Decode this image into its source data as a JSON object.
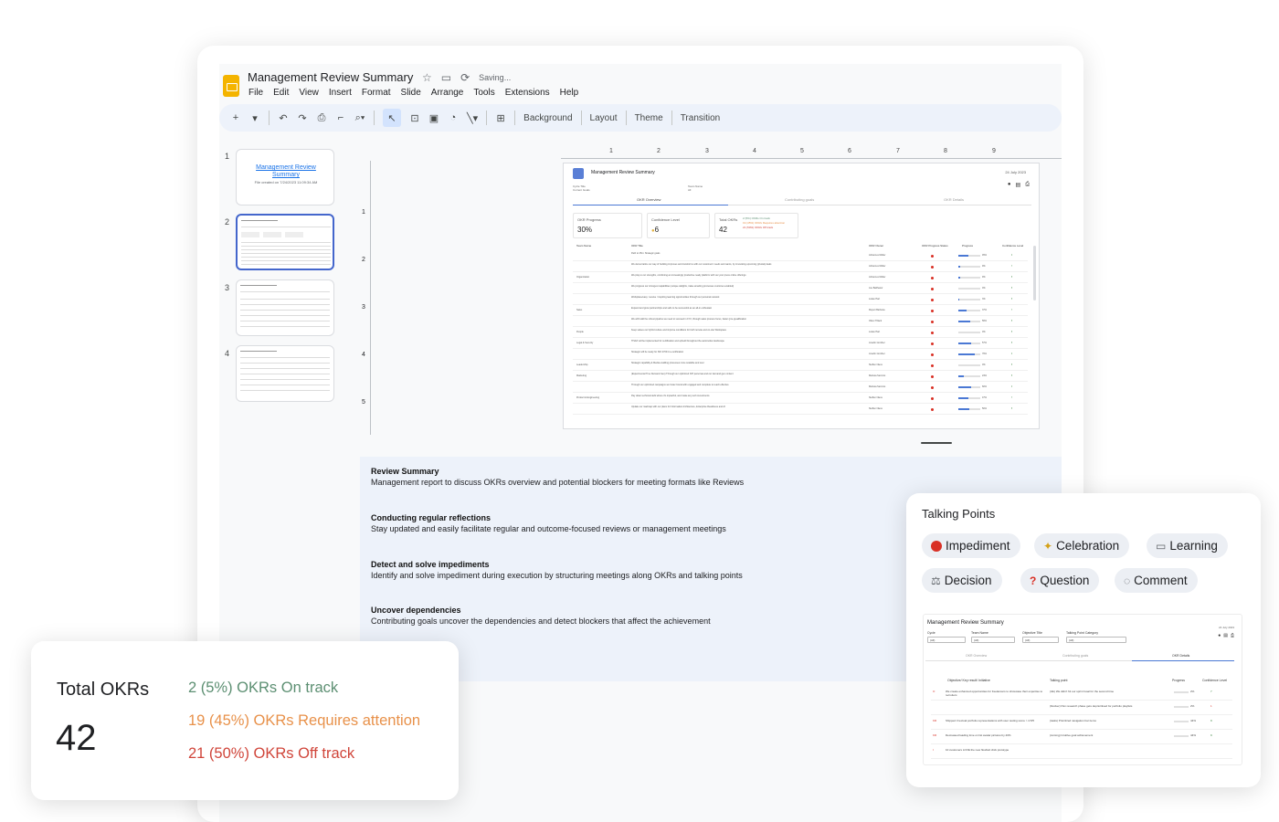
{
  "app": {
    "title": "Management Review Summary",
    "status": "Saving...",
    "menu": [
      "File",
      "Edit",
      "View",
      "Insert",
      "Format",
      "Slide",
      "Arrange",
      "Tools",
      "Extensions",
      "Help"
    ],
    "toolbar": {
      "background": "Background",
      "layout": "Layout",
      "theme": "Theme",
      "transition": "Transition"
    }
  },
  "filmstrip": {
    "slides": [
      {
        "number": "1",
        "title": "Management Review Summary",
        "subtitle": "File created on 7/24/2023 11:09:34 AM"
      },
      {
        "number": "2"
      },
      {
        "number": "3"
      },
      {
        "number": "4"
      }
    ]
  },
  "ruler": {
    "horizontal": [
      "1",
      "2",
      "3",
      "4",
      "5",
      "6",
      "7",
      "8",
      "9"
    ],
    "vertical": [
      "1",
      "2",
      "3",
      "4",
      "5"
    ]
  },
  "slide": {
    "title": "Management Review Summary",
    "date": "24 July 2023",
    "meta": {
      "cycle_label": "Cycle Title",
      "cycle_value": "Current Goals",
      "team_label": "Team Name",
      "team_value": "All"
    },
    "tabs": [
      "OKR Overview",
      "Contributing goals",
      "OKR Details"
    ],
    "cards": {
      "progress": {
        "label": "OKR Progress",
        "value": "30%"
      },
      "confidence": {
        "label": "Confidence Level",
        "value": "6"
      },
      "total": {
        "label": "Total OKRs",
        "value": "42",
        "on_track": "2 (5%) OKRs On track",
        "attention": "19 (45%) OKRs Requires attention",
        "off_track": "21 (50%) OKRs Off track"
      }
    },
    "table_headers": [
      "Team Name",
      "OKR Title",
      "OKR Owner",
      "OKR Progress Status",
      "Progress",
      "Confidence Level"
    ],
    "table_rows": [
      {
        "team": "",
        "title": "Path to 25m: Strategic goals",
        "owner": "Johannes Müller",
        "status": "#d93025",
        "progress": 0.45,
        "pct": "45%",
        "conf": "9"
      },
      {
        "team": "",
        "title": "We democratize our way of building improves and transforms with our customers' needs and wants, by innovating upcoming (pivotal) deals",
        "owner": "Johannes Müller",
        "status": "#d93025",
        "progress": 0.09,
        "pct": "9%",
        "conf": "7"
      },
      {
        "team": "Organization",
        "title": "We play to our strengths, combining an increasingly productive ready platform with our your press online offerings",
        "owner": "Johannes Müller",
        "status": "#d93025",
        "progress": 0.09,
        "pct": "9%",
        "conf": "8"
      },
      {
        "team": "",
        "title": "We progress our strongest capabilities (unique delights, make amazing processes customer-enabled)",
        "owner": "Joe Balthasor",
        "status": "#d93025",
        "progress": 0.0,
        "pct": "0%",
        "conf": "8"
      },
      {
        "team": "",
        "title": "Workplace/easy: receive / inspiring learning opportunities through our personal network",
        "owner": "Lukas Hart",
        "status": "#d93025",
        "progress": 0.03,
        "pct": "3%",
        "conf": "8"
      },
      {
        "team": "Sales",
        "title": "Expand and grow partnerships and sells to be successful as an all-in enthusiast",
        "owner": "Rupert Barbosa",
        "status": "#d93025",
        "progress": 0.37,
        "pct": "37%",
        "conf": "7"
      },
      {
        "team": "",
        "title": "We will build the robust pipeline we need to succeed in FY2, through sales process focus, faster (pre-)qualification",
        "owner": "Oliver Tillack",
        "status": "#d93025",
        "progress": 0.56,
        "pct": "56%",
        "conf": "8"
      },
      {
        "team": "People",
        "title": "Keep values our hybrid culture and improve conditions for both remote and on-site Workspace",
        "owner": "Lukas Hart",
        "status": "#d93025",
        "progress": 0.0,
        "pct": "0%",
        "conf": "8"
      },
      {
        "team": "Legal & Security",
        "title": "TISAX will be implemented for certification and upheld throughout the automotive landscape",
        "owner": "Josefin Günther",
        "status": "#d93025",
        "progress": 0.57,
        "pct": "57%",
        "conf": "8"
      },
      {
        "team": "",
        "title": "Strategic will be ready for ISO 27001 re-certification",
        "owner": "Josefin Günther",
        "status": "#d93025",
        "progress": 0.76,
        "pct": "76%",
        "conf": "9"
      },
      {
        "team": "Leadership",
        "title": "Strategic capability & Media enabling processes more scalable and over",
        "owner": "Steffen Niess",
        "status": "#d93025",
        "progress": 0.0,
        "pct": "0%",
        "conf": "8"
      },
      {
        "team": "Marketing",
        "title": "(Experimental True Demand Gen) Through our optimized ICP personas and our demand gen content",
        "owner": "Melissa Sammis",
        "status": "#d93025",
        "progress": 0.24,
        "pct": "24%",
        "conf": "8"
      },
      {
        "team": "",
        "title": "Through our optimized campaigns we foster brand with engaged and complete to reach effective",
        "owner": "Melissa Sammis",
        "status": "#d93025",
        "progress": 0.6,
        "pct": "60%",
        "conf": "9"
      },
      {
        "team": "Product & Engineering",
        "title": "Pay down technical debt where it's impactful, and make any tech investments",
        "owner": "Steffen Niess",
        "status": "#d93025",
        "progress": 0.47,
        "pct": "47%",
        "conf": "7"
      },
      {
        "team": "",
        "title": "Update our roadmap with our plans for Information Architecture, Enterprise Readiness and AI",
        "owner": "Steffen Niess",
        "status": "#d93025",
        "progress": 0.5,
        "pct": "50%",
        "conf": "8"
      }
    ]
  },
  "notes": [
    {
      "heading": "Review Summary",
      "text": "Management report to discuss OKRs overview and potential blockers for meeting formats like Reviews"
    },
    {
      "heading": "Conducting regular reflections",
      "text": "Stay updated and easily facilitate regular and outcome-focused reviews or management meetings"
    },
    {
      "heading": "Detect and solve impediments",
      "text": "Identify and solve impediment during execution by structuring meetings along OKRs and talking points"
    },
    {
      "heading": "Uncover dependencies",
      "text": "Contributing goals uncover the dependencies and detect blockers that affect the achievement"
    }
  ],
  "okr_summary": {
    "label": "Total OKRs",
    "count": "42",
    "on_track": "2 (5%) OKRs On track",
    "attention": "19 (45%) OKRs Requires attention",
    "off_track": "21 (50%) OKRs Off track",
    "colors": {
      "on_track": "#5c8f72",
      "attention": "#e8914a",
      "off_track": "#d0453a"
    }
  },
  "talking_points": {
    "title": "Talking Points",
    "chips": [
      {
        "label": "Impediment",
        "icon": "red-circle-icon"
      },
      {
        "label": "Celebration",
        "icon": "party-popper-icon"
      },
      {
        "label": "Learning",
        "icon": "book-icon"
      },
      {
        "label": "Decision",
        "icon": "scales-icon"
      },
      {
        "label": "Question",
        "icon": "question-mark-icon"
      },
      {
        "label": "Comment",
        "icon": "speech-bubble-icon"
      }
    ],
    "report": {
      "title": "Management Review Summary",
      "date": "24 July 2023",
      "filters": [
        {
          "label": "Cycle",
          "value": "(All)"
        },
        {
          "label": "Team Name",
          "value": "(All)"
        },
        {
          "label": "Objective Title",
          "value": "(All)"
        },
        {
          "label": "Talking Point Category",
          "value": "(All)"
        }
      ],
      "tabs": [
        "OKR Overview",
        "Contributing goals",
        "OKR Details"
      ],
      "headers": [
        "Objective/ Key result/ Initiative",
        "Talking point",
        "Progress",
        "Confidence Level"
      ],
      "rows": [
        {
          "marker": "O",
          "objective": "We create enhanced opportunities for freelancers to showcase their expertise to recruiters",
          "point": "(rkk) We didn't hit our sprint Goal for the second time",
          "pct": "2%",
          "conf": "7"
        },
        {
          "marker": "",
          "objective": "",
          "point": "(blocker) Pan research phase gets deprioritised for portfolio playlists",
          "pct": "2%",
          "conf": "1"
        },
        {
          "marker": "KR",
          "objective": "Shipped 3 textual portfolio representations with user testing score > 4.5/5",
          "point": "(tasks) Prioritized navigation bar items",
          "pct": "44%",
          "conf": "9"
        },
        {
          "marker": "KR",
          "objective": "Decreased loading time on list avatar pictures by 40%",
          "point": "(cursing) Intuitive goal achievement",
          "pct": "44%",
          "conf": "9"
        },
        {
          "marker": "I",
          "objective": "10 customers LOVE the new flowfact click prototype",
          "point": "",
          "pct": "",
          "conf": ""
        }
      ]
    }
  }
}
